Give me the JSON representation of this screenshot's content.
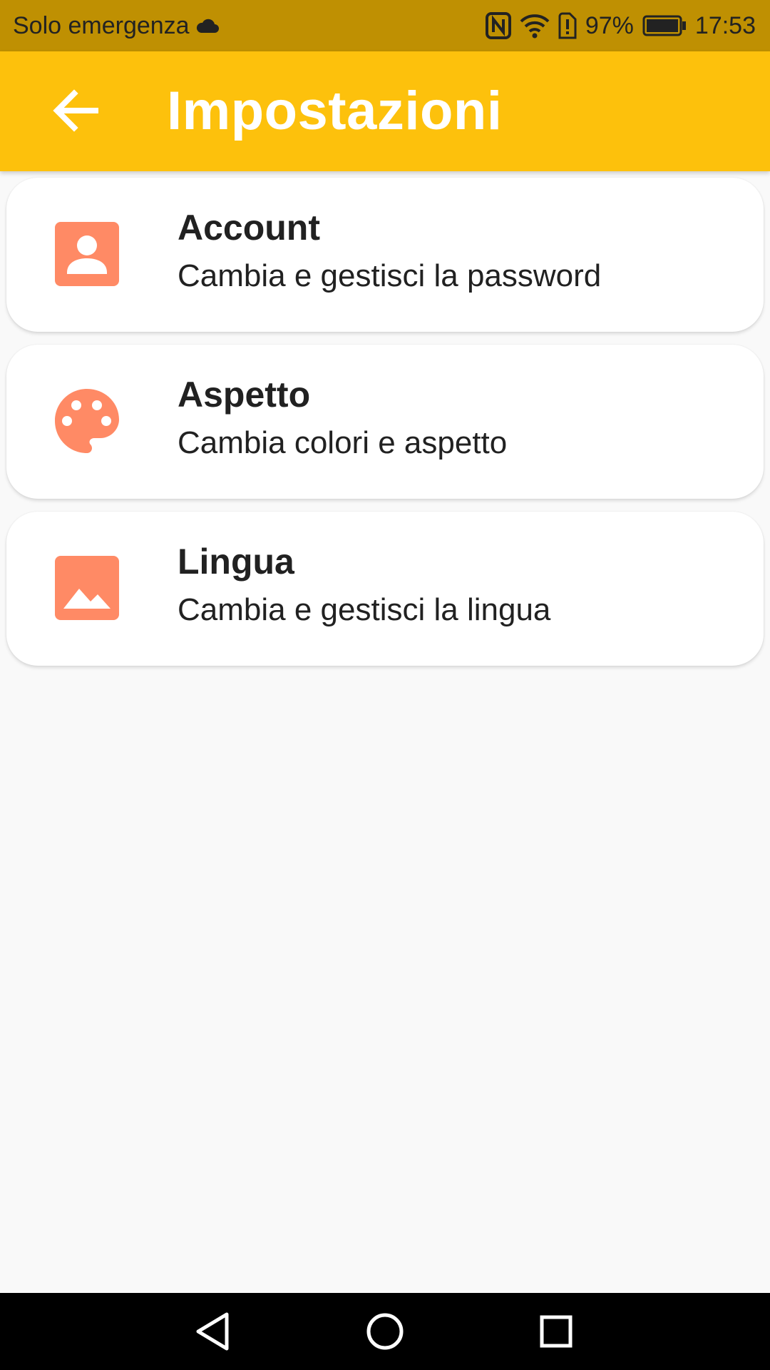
{
  "status_bar": {
    "carrier": "Solo emergenza",
    "battery_percent": "97%",
    "time": "17:53",
    "icons": [
      "cloud-icon",
      "nfc-icon",
      "wifi-icon",
      "battery-alert-icon",
      "battery-icon"
    ]
  },
  "app_bar": {
    "title": "Impostazioni",
    "back_icon": "arrow-back-icon"
  },
  "settings": [
    {
      "title": "Account",
      "subtitle": "Cambia e gestisci la password",
      "icon": "account-box-icon"
    },
    {
      "title": "Aspetto",
      "subtitle": "Cambia colori e aspetto",
      "icon": "palette-icon"
    },
    {
      "title": "Lingua",
      "subtitle": "Cambia e gestisci la lingua",
      "icon": "image-icon"
    }
  ],
  "nav_bar": {
    "icons": [
      "back-triangle-icon",
      "home-circle-icon",
      "recents-square-icon"
    ]
  },
  "colors": {
    "status_bar": "#bf9002",
    "app_bar": "#fdc10c",
    "icon_accent": "#ff8a65",
    "background": "#f9f9f9"
  }
}
